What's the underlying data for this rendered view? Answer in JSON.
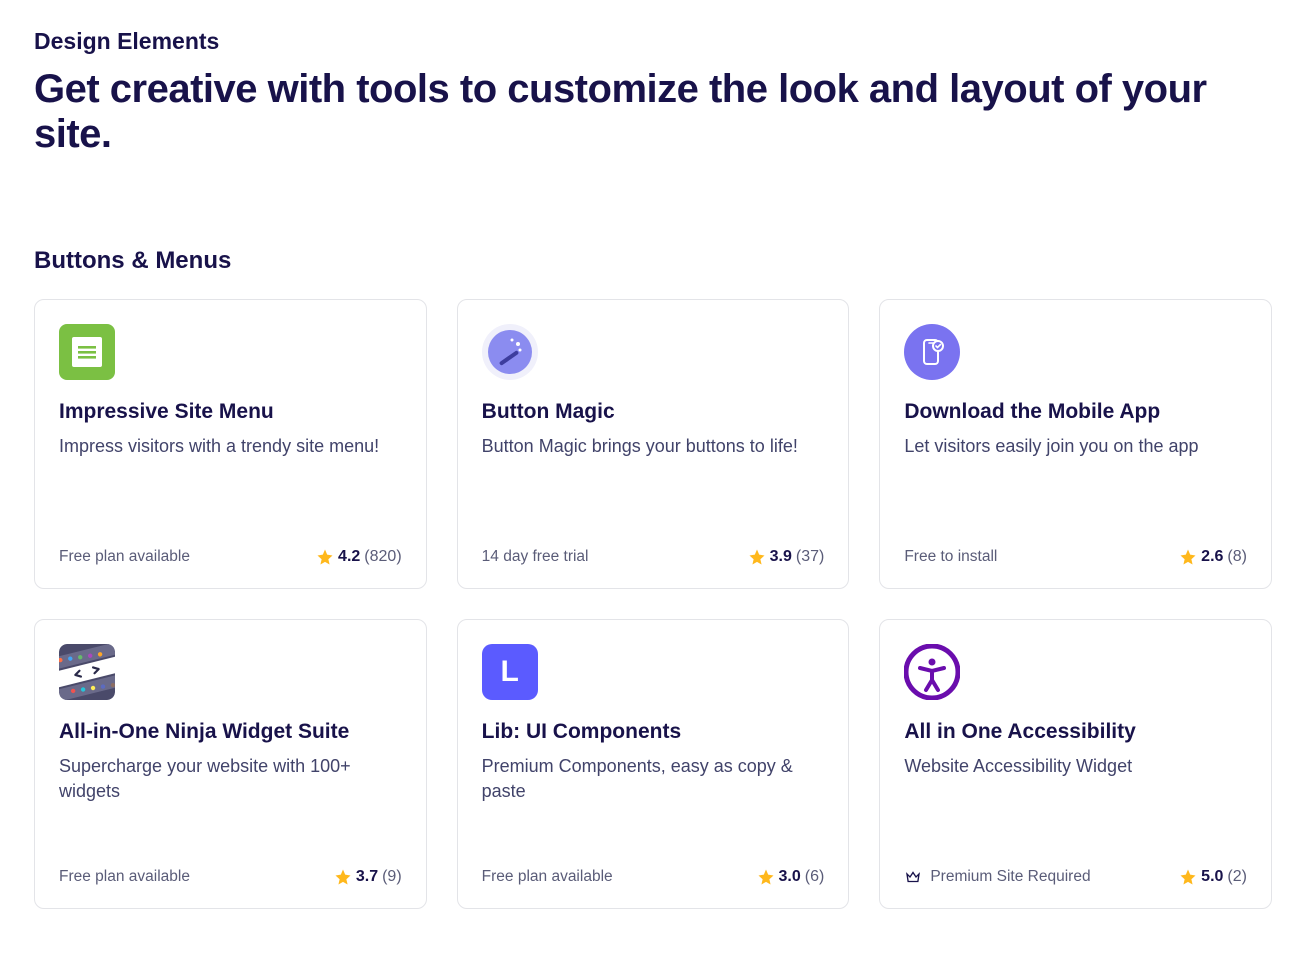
{
  "header": {
    "category": "Design Elements",
    "title": "Get creative with tools to customize the look and layout of your site."
  },
  "section": {
    "title": "Buttons & Menus"
  },
  "cards": [
    {
      "icon": "menu-icon",
      "title": "Impressive Site Menu",
      "desc": "Impress visitors with a trendy site menu!",
      "pricing": "Free plan available",
      "premium": false,
      "rating": "4.2",
      "count": "(820)"
    },
    {
      "icon": "wand-icon",
      "title": "Button Magic",
      "desc": "Button Magic brings your buttons to life!",
      "pricing": "14 day free trial",
      "premium": false,
      "rating": "3.9",
      "count": "(37)"
    },
    {
      "icon": "mobile-icon",
      "title": "Download the Mobile App",
      "desc": "Let visitors easily join you on the app",
      "pricing": "Free to install",
      "premium": false,
      "rating": "2.6",
      "count": "(8)"
    },
    {
      "icon": "ninja-icon",
      "title": "All-in-One Ninja Widget Suite",
      "desc": "Supercharge your website with 100+ widgets",
      "pricing": "Free plan available",
      "premium": false,
      "rating": "3.7",
      "count": "(9)"
    },
    {
      "icon": "lib-icon",
      "title": "Lib: UI Components",
      "desc": "Premium Components, easy as copy & paste",
      "pricing": "Free plan available",
      "premium": false,
      "rating": "3.0",
      "count": "(6)"
    },
    {
      "icon": "accessibility-icon",
      "title": "All in One Accessibility",
      "desc": "Website Accessibility Widget",
      "pricing": "Premium Site Required",
      "premium": true,
      "rating": "5.0",
      "count": "(2)"
    }
  ]
}
